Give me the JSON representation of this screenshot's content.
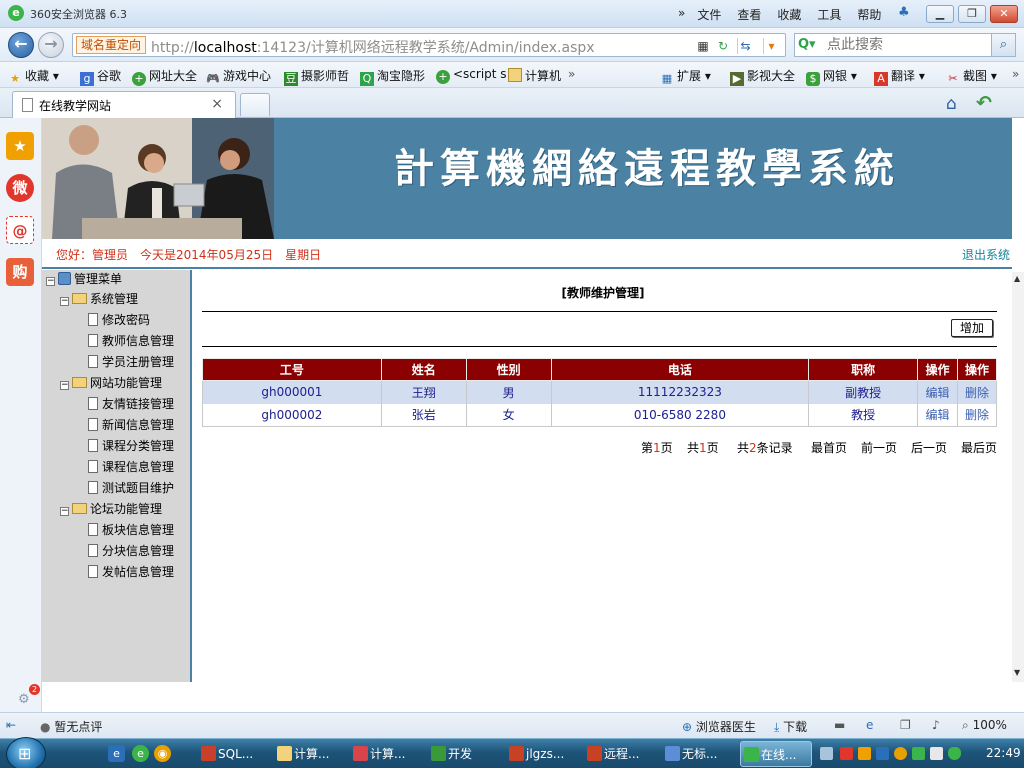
{
  "browser": {
    "title": "360安全浏览器 6.3",
    "menus": [
      "文件",
      "查看",
      "收藏",
      "工具",
      "帮助"
    ],
    "redirect_label": "域名重定向",
    "url_prefix": "http://",
    "url_host": "localhost",
    "url_rest": ":14123/计算机网络远程教学系统/Admin/index.aspx",
    "search_placeholder": "点此搜索",
    "window_controls": [
      "minimize",
      "restore",
      "close"
    ]
  },
  "favorites": {
    "items": [
      "收藏",
      "谷歌",
      "网址大全",
      "游戏中心",
      "摄影师哲",
      "淘宝隐形",
      "<script s",
      "计算机"
    ],
    "right_items": [
      "扩展",
      "影视大全",
      "网银",
      "翻译",
      "截图"
    ]
  },
  "tabs": {
    "active_label": "在线教学网站",
    "close": "×"
  },
  "sidestrip": {
    "notification_count": "2"
  },
  "site": {
    "banner_title": "計算機網絡遠程教學系統",
    "greeting_user": "您好：管理员",
    "greeting_date": "今天是2014年05月25日",
    "greeting_weekday": "星期日",
    "logout": "退出系统"
  },
  "tree": {
    "root": "管理菜单",
    "groups": [
      {
        "label": "系统管理",
        "items": [
          "修改密码",
          "教师信息管理",
          "学员注册管理"
        ]
      },
      {
        "label": "网站功能管理",
        "items": [
          "友情链接管理",
          "新闻信息管理",
          "课程分类管理",
          "课程信息管理",
          "测试题目维护"
        ]
      },
      {
        "label": "论坛功能管理",
        "items": [
          "板块信息管理",
          "分块信息管理",
          "发帖信息管理"
        ]
      }
    ]
  },
  "main": {
    "heading": "[教师维护管理]",
    "add_button": "增加",
    "columns": [
      "工号",
      "姓名",
      "性别",
      "电话",
      "职称",
      "操作",
      "操作"
    ],
    "rows": [
      {
        "id": "gh000001",
        "name": "王翔",
        "gender": "男",
        "phone": "11112232323",
        "title": "副教授",
        "edit": "编辑",
        "delete": "删除"
      },
      {
        "id": "gh000002",
        "name": "张岩",
        "gender": "女",
        "phone": "010-6580 2280",
        "title": "教授",
        "edit": "编辑",
        "delete": "删除"
      }
    ],
    "pager": {
      "page_pre": "第",
      "page_num": "1",
      "page_suf": "页",
      "total_pre": "共",
      "total_num": "1",
      "total_suf": "页",
      "rec_pre": "共",
      "rec_num": "2",
      "rec_suf": "条记录",
      "first": "最首页",
      "prev": "前一页",
      "next": "后一页",
      "last": "最后页"
    }
  },
  "statusbar": {
    "comment": "暂无点评",
    "doctor": "浏览器医生",
    "download": "下载",
    "zoom": "100%"
  },
  "taskbar": {
    "tasks": [
      "SQL...",
      "计算...",
      "计算...",
      "开发",
      "jlgzs...",
      "远程...",
      "无标...",
      "在线..."
    ],
    "clock": "22:49"
  },
  "colors": {
    "banner": "#4b82a3",
    "table_header": "#8b0000",
    "greeting_text": "#d0321a",
    "selected_row": "#d2def0"
  }
}
